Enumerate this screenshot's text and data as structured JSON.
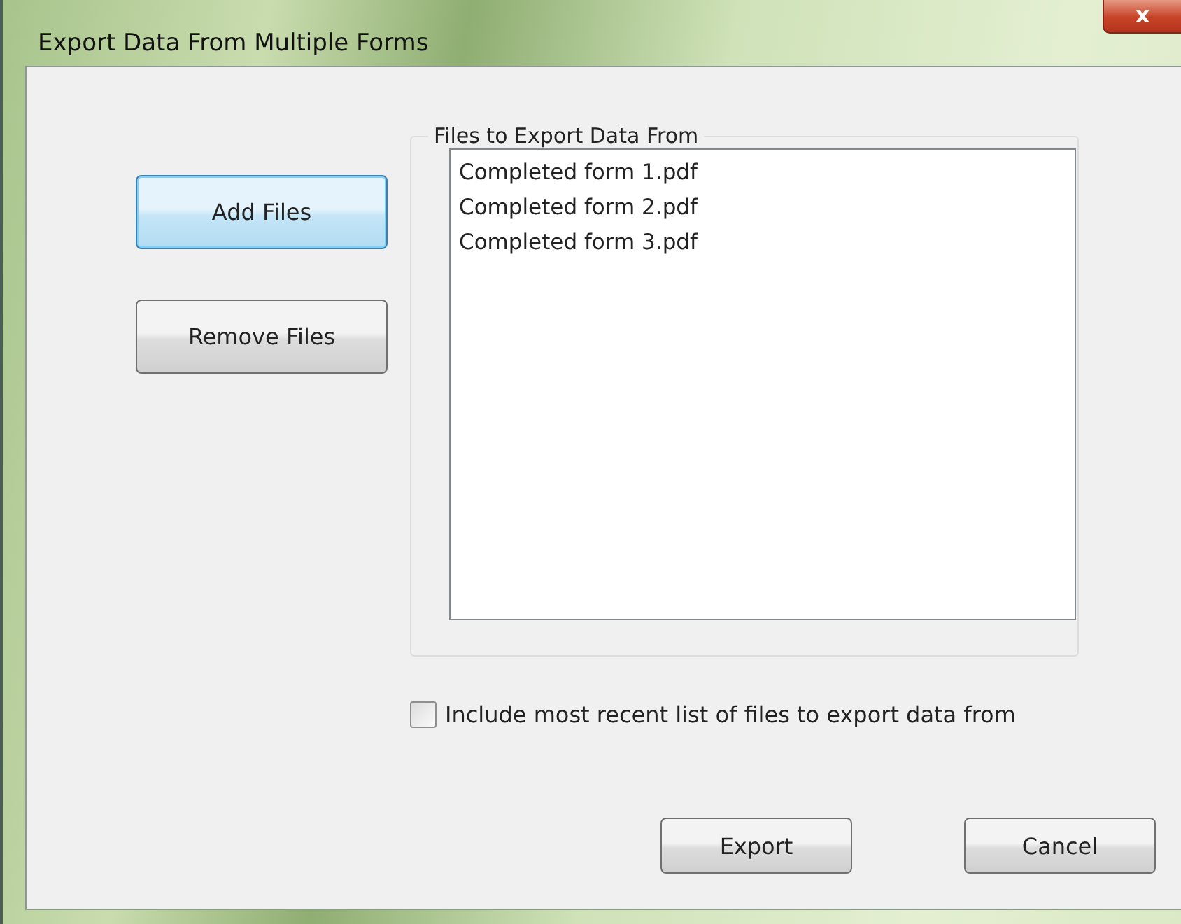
{
  "window": {
    "title": "Export Data From Multiple Forms",
    "close": "x"
  },
  "side_buttons": [
    {
      "label": "Add Files",
      "focused": true
    },
    {
      "label": "Remove Files",
      "focused": false
    }
  ],
  "files_group": {
    "title": "Files to Export Data From",
    "items": [
      "Completed form 1.pdf",
      "Completed form 2.pdf",
      "Completed form 3.pdf"
    ]
  },
  "include_recent": {
    "label": "Include most recent list of files to export data from",
    "checked": false
  },
  "buttons": [
    "Export",
    "Cancel"
  ]
}
